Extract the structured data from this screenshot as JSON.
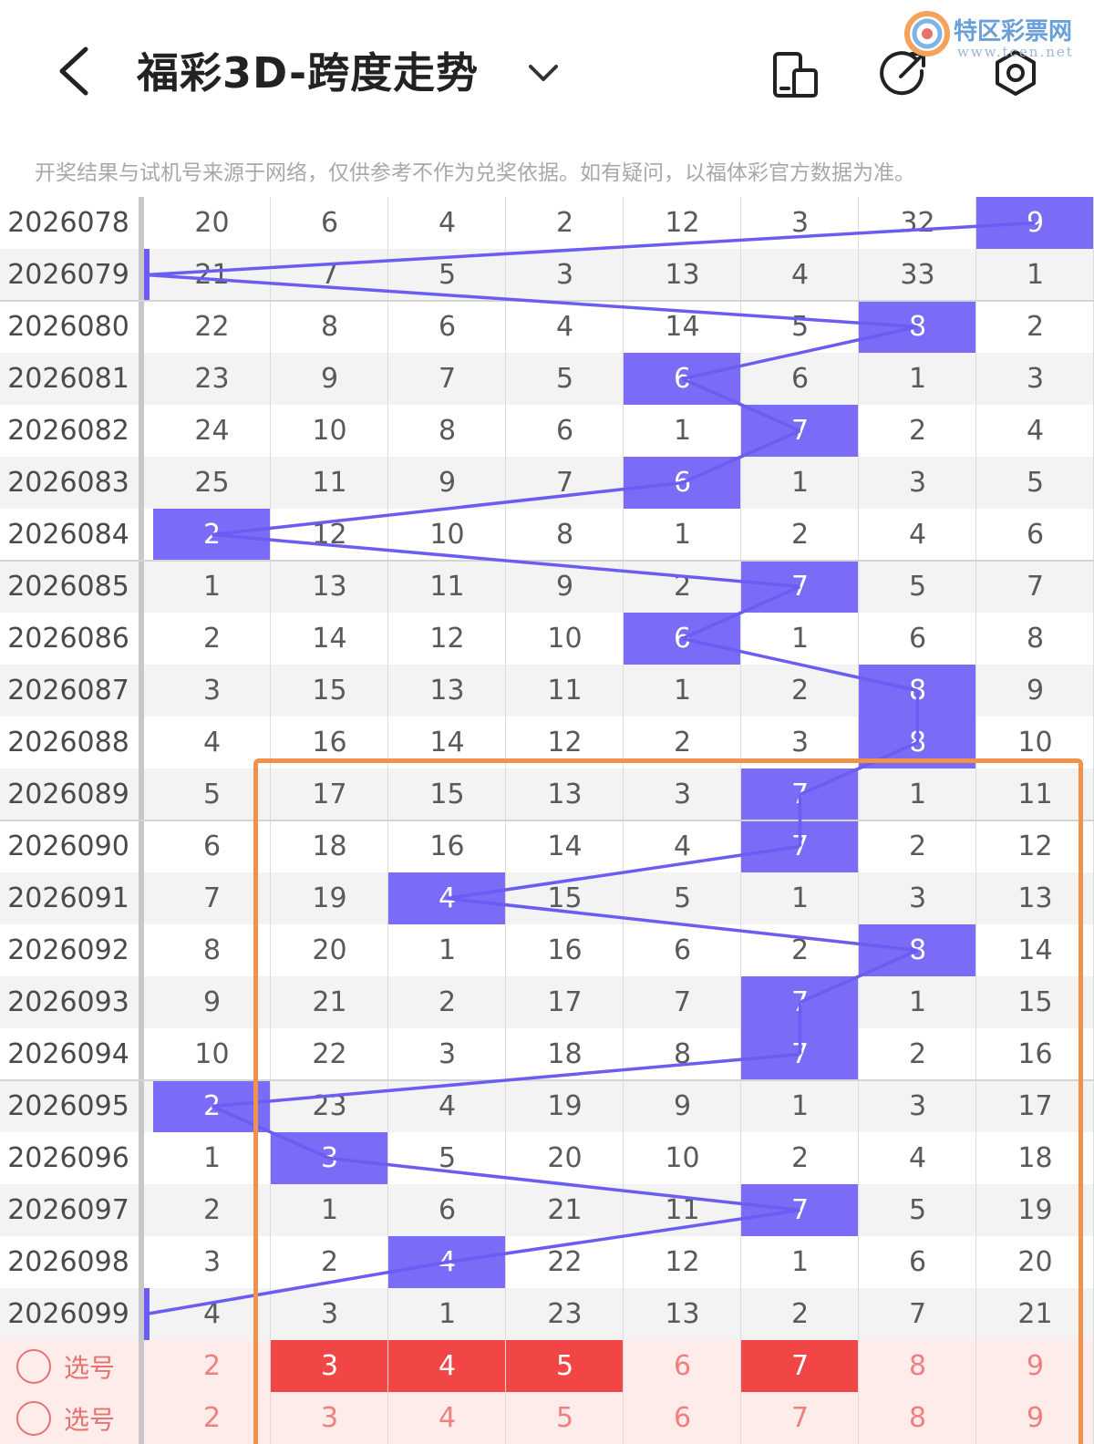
{
  "header": {
    "title": "福彩3D-跨度走势",
    "watermark_text": "特区彩票网",
    "watermark_url": "www.tcen.net"
  },
  "notice": "开奖结果与试机号来源于网络，仅供参考不作为兑奖依据。如有疑问，以福体彩官方数据为准。",
  "icons": {
    "back": "chevron-left-icon",
    "title_dropdown": "chevron-down-icon",
    "layout": "phone-layout-icon",
    "share": "share-icon",
    "settings": "gear-icon"
  },
  "colors": {
    "hit": "#7a6cf7",
    "line": "#6b5cf2",
    "pick_selected": "#f24646",
    "pick_row_bg": "#fdecea",
    "highlight_box": "#f0924a"
  },
  "table": {
    "rows": [
      {
        "issue": "2026078",
        "cells": [
          "20",
          "6",
          "4",
          "2",
          "12",
          "3",
          "32",
          "9"
        ],
        "span": 9,
        "stripe": false
      },
      {
        "issue": "2026079",
        "cells": [
          "21",
          "7",
          "5",
          "3",
          "13",
          "4",
          "33",
          "1"
        ],
        "span": 0,
        "stripe": true
      },
      {
        "issue": "2026080",
        "cells": [
          "22",
          "8",
          "6",
          "4",
          "14",
          "5",
          "8",
          "2"
        ],
        "span": 8,
        "stripe": false
      },
      {
        "issue": "2026081",
        "cells": [
          "23",
          "9",
          "7",
          "5",
          "6",
          "6",
          "1",
          "3"
        ],
        "span": 6,
        "stripe": true
      },
      {
        "issue": "2026082",
        "cells": [
          "24",
          "10",
          "8",
          "6",
          "1",
          "7",
          "2",
          "4"
        ],
        "span": 7,
        "stripe": false
      },
      {
        "issue": "2026083",
        "cells": [
          "25",
          "11",
          "9",
          "7",
          "6",
          "1",
          "3",
          "5"
        ],
        "span": 6,
        "stripe": true
      },
      {
        "issue": "2026084",
        "cells": [
          "2",
          "12",
          "10",
          "8",
          "1",
          "2",
          "4",
          "6"
        ],
        "span": 2,
        "stripe": false
      },
      {
        "issue": "2026085",
        "cells": [
          "1",
          "13",
          "11",
          "9",
          "2",
          "7",
          "5",
          "7"
        ],
        "span": 7,
        "stripe": true
      },
      {
        "issue": "2026086",
        "cells": [
          "2",
          "14",
          "12",
          "10",
          "6",
          "1",
          "6",
          "8"
        ],
        "span": 6,
        "stripe": false
      },
      {
        "issue": "2026087",
        "cells": [
          "3",
          "15",
          "13",
          "11",
          "1",
          "2",
          "8",
          "9"
        ],
        "span": 8,
        "stripe": true
      },
      {
        "issue": "2026088",
        "cells": [
          "4",
          "16",
          "14",
          "12",
          "2",
          "3",
          "8",
          "10"
        ],
        "span": 8,
        "stripe": false
      },
      {
        "issue": "2026089",
        "cells": [
          "5",
          "17",
          "15",
          "13",
          "3",
          "7",
          "1",
          "11"
        ],
        "span": 7,
        "stripe": true
      },
      {
        "issue": "2026090",
        "cells": [
          "6",
          "18",
          "16",
          "14",
          "4",
          "7",
          "2",
          "12"
        ],
        "span": 7,
        "stripe": false
      },
      {
        "issue": "2026091",
        "cells": [
          "7",
          "19",
          "4",
          "15",
          "5",
          "1",
          "3",
          "13"
        ],
        "span": 4,
        "stripe": true
      },
      {
        "issue": "2026092",
        "cells": [
          "8",
          "20",
          "1",
          "16",
          "6",
          "2",
          "8",
          "14"
        ],
        "span": 8,
        "stripe": false
      },
      {
        "issue": "2026093",
        "cells": [
          "9",
          "21",
          "2",
          "17",
          "7",
          "7",
          "1",
          "15"
        ],
        "span": 7,
        "stripe": true
      },
      {
        "issue": "2026094",
        "cells": [
          "10",
          "22",
          "3",
          "18",
          "8",
          "7",
          "2",
          "16"
        ],
        "span": 7,
        "stripe": false
      },
      {
        "issue": "2026095",
        "cells": [
          "2",
          "23",
          "4",
          "19",
          "9",
          "1",
          "3",
          "17"
        ],
        "span": 2,
        "stripe": true
      },
      {
        "issue": "2026096",
        "cells": [
          "1",
          "3",
          "5",
          "20",
          "10",
          "2",
          "4",
          "18"
        ],
        "span": 3,
        "stripe": false
      },
      {
        "issue": "2026097",
        "cells": [
          "2",
          "1",
          "6",
          "21",
          "11",
          "7",
          "5",
          "19"
        ],
        "span": 7,
        "stripe": true
      },
      {
        "issue": "2026098",
        "cells": [
          "3",
          "2",
          "4",
          "22",
          "12",
          "1",
          "6",
          "20"
        ],
        "span": 4,
        "stripe": false
      },
      {
        "issue": "2026099",
        "cells": [
          "4",
          "3",
          "1",
          "23",
          "13",
          "2",
          "7",
          "21"
        ],
        "span": 0,
        "stripe": true
      }
    ],
    "pick_rows": [
      {
        "label": "选号",
        "cells": [
          "2",
          "3",
          "4",
          "5",
          "6",
          "7",
          "8",
          "9"
        ],
        "selected": [
          false,
          true,
          true,
          true,
          false,
          true,
          false,
          false
        ]
      },
      {
        "label": "选号",
        "cells": [
          "2",
          "3",
          "4",
          "5",
          "6",
          "7",
          "8",
          "9"
        ],
        "selected": [
          false,
          false,
          false,
          false,
          false,
          false,
          false,
          false
        ]
      }
    ]
  }
}
